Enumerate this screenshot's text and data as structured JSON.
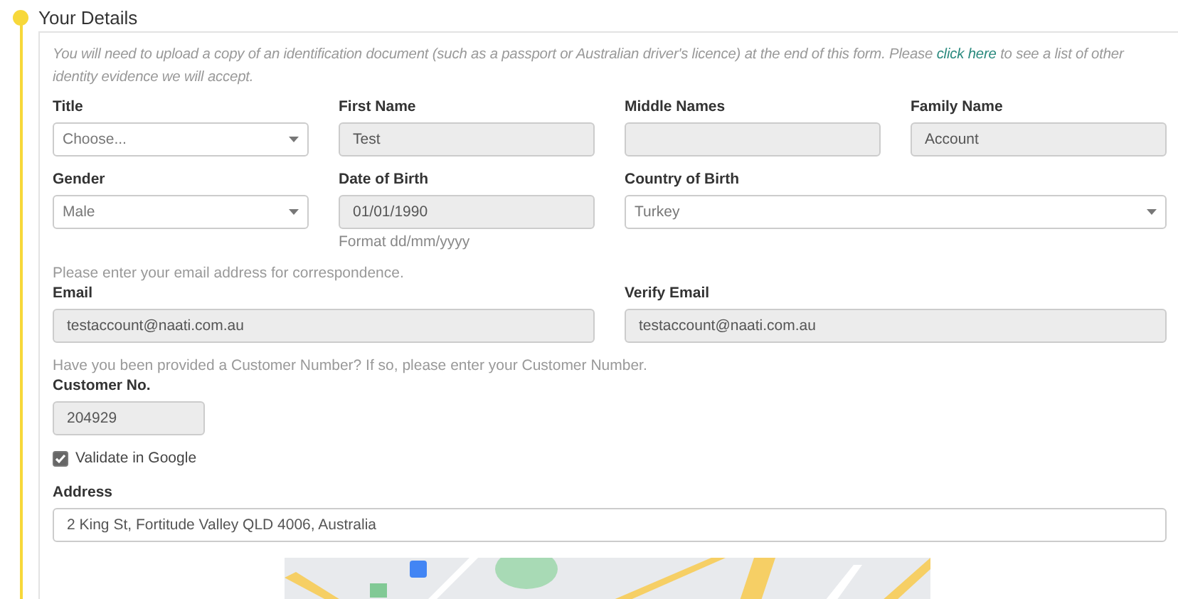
{
  "section": {
    "title": "Your Details"
  },
  "intro": {
    "text": "You will need to upload a copy of an identification document (such as a passport or Australian driver's licence) at the end of this form.  Please ",
    "link": "click here",
    "after": " to see a list of other identity evidence we will accept."
  },
  "rows": [
    {
      "fields": [
        {
          "label": "Title",
          "kind": "select",
          "placeholder": "Choose...",
          "disabled": false
        },
        {
          "label": "First Name",
          "kind": "text",
          "value": "Test",
          "disabled": true
        },
        {
          "label": "Middle Names",
          "kind": "text",
          "disabled": true
        },
        {
          "label": "Family Name",
          "kind": "text",
          "value": "Account",
          "disabled": true
        }
      ]
    },
    {
      "fields": [
        {
          "label": "Gender",
          "kind": "select",
          "value": "Male",
          "disabled": false
        },
        {
          "label": "Date of Birth",
          "kind": "text",
          "value": "01/01/1990",
          "disabled": true,
          "help": "Format dd/mm/yyyy"
        },
        {
          "label": "Country of Birth",
          "kind": "select",
          "value": "Turkey",
          "disabled": false
        }
      ]
    }
  ],
  "email": {
    "hint": "Please enter your email address for correspondence.",
    "fields": [
      {
        "label": "Email",
        "value": "testaccount@naati.com.au",
        "disabled": true
      },
      {
        "label": "Verify Email",
        "value": "testaccount@naati.com.au",
        "disabled": true
      }
    ]
  },
  "customer": {
    "hint": "Have you been provided a Customer Number? If so, please enter your Customer Number.",
    "label": "Customer No.",
    "value": "204929",
    "disabled": true
  },
  "validate": {
    "label": "Validate in Google",
    "checked": true
  },
  "address": {
    "label": "Address",
    "value": "2 King St, Fortitude Valley QLD 4006, Australia",
    "disabled": false
  }
}
